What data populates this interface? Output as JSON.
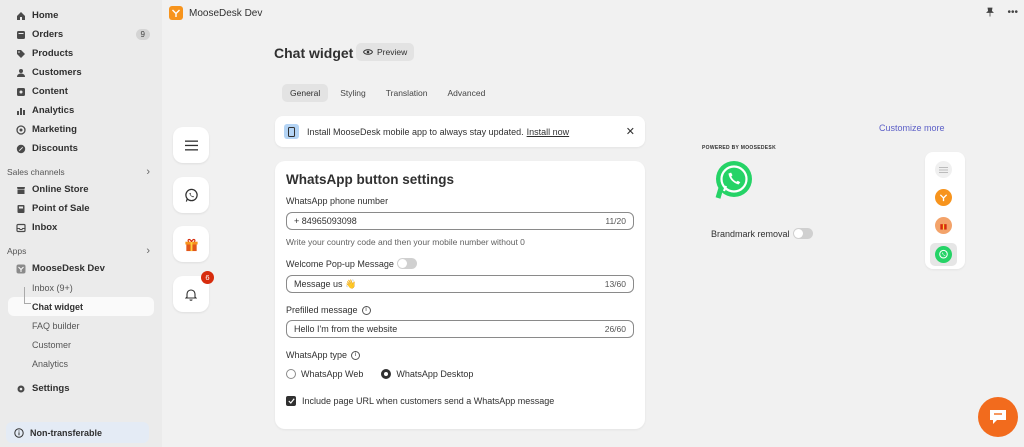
{
  "sidebar": {
    "items": [
      {
        "label": "Home",
        "icon": "home-icon"
      },
      {
        "label": "Orders",
        "icon": "orders-icon",
        "badge": "9"
      },
      {
        "label": "Products",
        "icon": "tag-icon"
      },
      {
        "label": "Customers",
        "icon": "person-icon"
      },
      {
        "label": "Content",
        "icon": "content-icon"
      },
      {
        "label": "Analytics",
        "icon": "bar-chart-icon"
      },
      {
        "label": "Marketing",
        "icon": "target-icon"
      },
      {
        "label": "Discounts",
        "icon": "discount-icon"
      }
    ],
    "sales_channels_title": "Sales channels",
    "sales_channels": [
      {
        "label": "Online Store",
        "icon": "store-icon"
      },
      {
        "label": "Point of Sale",
        "icon": "pos-icon"
      },
      {
        "label": "Inbox",
        "icon": "inbox-icon"
      }
    ],
    "apps_title": "Apps",
    "app_name": "MooseDesk Dev",
    "app_sub": [
      {
        "label": "Inbox (9+)"
      },
      {
        "label": "Chat widget"
      },
      {
        "label": "FAQ builder"
      },
      {
        "label": "Customer"
      },
      {
        "label": "Analytics"
      }
    ],
    "settings": "Settings",
    "non_transferable": "Non-transferable"
  },
  "topbar": {
    "title": "MooseDesk Dev"
  },
  "page": {
    "title": "Chat widget",
    "preview_label": "Preview",
    "tabs": [
      "General",
      "Styling",
      "Translation",
      "Advanced"
    ],
    "active_tab": "General"
  },
  "rail": {
    "notification_count": "6"
  },
  "banner": {
    "text": "Install MooseDesk mobile app to always stay updated.",
    "link": "Install now"
  },
  "card": {
    "title": "WhatsApp button settings",
    "phone_label": "WhatsApp phone number",
    "phone_value": "+ 84965093098",
    "phone_count": "11/20",
    "phone_help": "Write your country code and then your mobile number without 0",
    "popup_label": "Welcome Pop-up Message",
    "popup_value": "Message us 👋",
    "popup_count": "13/60",
    "prefilled_label": "Prefilled message",
    "prefilled_value": "Hello I'm from the website",
    "prefilled_count": "26/60",
    "type_label": "WhatsApp type",
    "type_options": [
      "WhatsApp Web",
      "WhatsApp Desktop"
    ],
    "type_selected": "WhatsApp Desktop",
    "include_url_label": "Include page URL when customers send a WhatsApp message",
    "include_url_checked": true
  },
  "preview": {
    "customize_more": "Customize more",
    "powered_by": "POWERED BY MOOSEDESK",
    "brandmark_removal": "Brandmark removal"
  },
  "colors": {
    "accent": "#f7941d",
    "link": "#5c5fc7",
    "whatsapp": "#25d366",
    "chat": "#f26b1d"
  }
}
